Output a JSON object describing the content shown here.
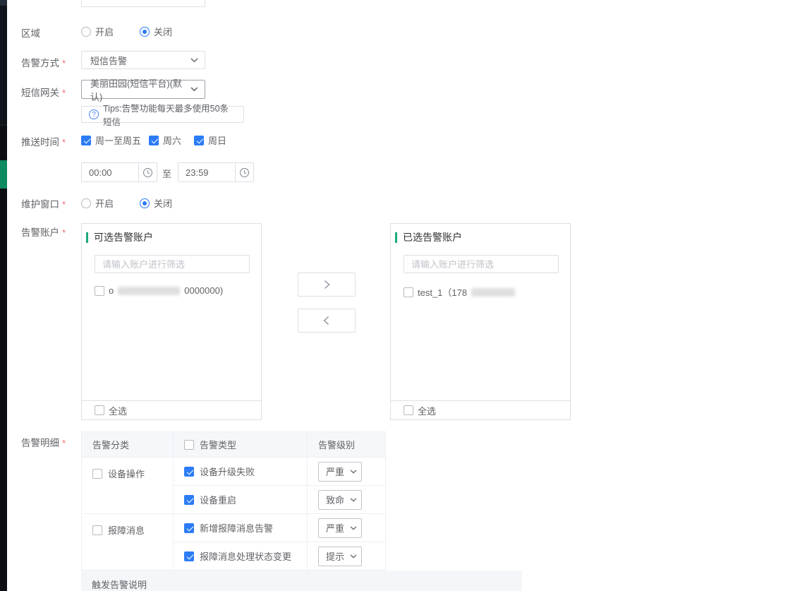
{
  "colors": {
    "primary_blue": "#2b7cf6",
    "accent_green": "#1aa97c",
    "sidebar_dark": "#0b0f14",
    "sidebar_green": "#0e8a5f",
    "required_red": "#f56c6c"
  },
  "required_mark": "*",
  "icons": {
    "tips_help": "?"
  },
  "form": {
    "region": {
      "label": "区域",
      "options": [
        {
          "label": "开启"
        },
        {
          "label": "关闭"
        }
      ]
    },
    "alert_method": {
      "label": "告警方式",
      "value": "短信告警"
    },
    "sms_gateway": {
      "label": "短信网关",
      "value": "美丽田园(短信平台)(默认)",
      "tips": "Tips:告警功能每天最多使用50条短信"
    },
    "push_time": {
      "label": "推送时间",
      "days": [
        {
          "label": "周一至周五"
        },
        {
          "label": "周六"
        },
        {
          "label": "周日"
        }
      ],
      "time_from": "00:00",
      "time_separator": "至",
      "time_to": "23:59"
    },
    "maintenance_window": {
      "label": "维护窗口",
      "options": [
        {
          "label": "开启"
        },
        {
          "label": "关闭"
        }
      ]
    },
    "alert_accounts": {
      "label": "告警账户",
      "available": {
        "title": "可选告警账户",
        "search_placeholder": "请输入账户进行筛选",
        "items": [
          {
            "prefix": "o",
            "suffix": "0000000)"
          }
        ],
        "select_all": "全选"
      },
      "selected": {
        "title": "已选告警账户",
        "search_placeholder": "请输入账户进行筛选",
        "items": [
          {
            "prefix": "test_1（178",
            "suffix": ""
          }
        ],
        "select_all": "全选"
      }
    },
    "alert_details": {
      "label": "告警明细",
      "table": {
        "headers": [
          "告警分类",
          "告警类型",
          "告警级别"
        ],
        "groups": [
          {
            "category": "设备操作",
            "rows": [
              {
                "type": "设备升级失败",
                "level": "严重"
              },
              {
                "type": "设备重启",
                "level": "致命"
              }
            ]
          },
          {
            "category": "报障消息",
            "rows": [
              {
                "type": "新增报障消息告警",
                "level": "严重"
              },
              {
                "type": "报障消息处理状态变更",
                "level": "提示"
              }
            ]
          }
        ]
      },
      "footer_note": "触发告警说明"
    }
  }
}
